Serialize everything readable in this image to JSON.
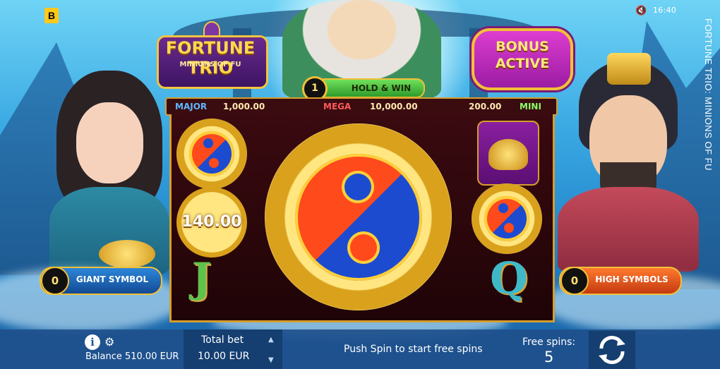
{
  "brand": {
    "letter": "B"
  },
  "status": {
    "time": "16:40",
    "sound_icon": "speaker-muted-icon"
  },
  "game_title": "FORTUNE TRIO: MINIONS OF FU",
  "logo": {
    "line1": "FORTUNE TRIO",
    "line2": "MINIONS OF FU"
  },
  "bonus_badge": {
    "line1": "BONUS",
    "line2": "ACTIVE"
  },
  "hold_win": {
    "count": "1",
    "label": "HOLD & WIN"
  },
  "jackpots": {
    "major": {
      "label": "MAJOR",
      "value": "1,000.00"
    },
    "mega": {
      "label": "MEGA",
      "value": "10,000.00"
    },
    "mini": {
      "label": "MINI",
      "value": "200.00"
    }
  },
  "reels": {
    "coin_value": "140.00",
    "symbols": [
      "yin-yang",
      "coin-140",
      "J",
      "giant-yin-yang",
      "gold-ingot",
      "yin-yang",
      "Q"
    ]
  },
  "left_counter": {
    "count": "0",
    "label": "GIANT SYMBOL"
  },
  "right_counter": {
    "count": "0",
    "label": "HIGH SYMBOLS"
  },
  "bottom": {
    "balance": "Balance 510.00 EUR",
    "total_bet_label": "Total bet",
    "total_bet_value": "10.00 EUR",
    "message": "Push Spin to start free spins",
    "free_spins_label": "Free spins:",
    "free_spins_value": "5"
  },
  "colors": {
    "gold": "#f2c037",
    "bonus": "#c82ec0",
    "hold_win": "#3fbf36",
    "high_symbols": "#e5541c",
    "bottom_bar": "#1e508c"
  }
}
